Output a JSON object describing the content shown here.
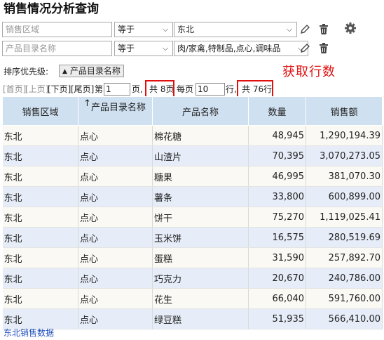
{
  "title": "销售情况分析查询",
  "filters": [
    {
      "field_placeholder": "销售区域",
      "operator": "等于",
      "value": "东北"
    },
    {
      "field_placeholder": "产品目录名称",
      "operator": "等于",
      "value": "肉/家禽,特制品,点心,调味品"
    }
  ],
  "icons": {
    "edit": "pencil-icon",
    "delete": "trash-icon",
    "settings": "gear-icon",
    "dropdown": "chevron-down-icon",
    "sort": "sort-up-triangle-icon"
  },
  "sort": {
    "label": "排序优先级:",
    "chip": "产品目录名称"
  },
  "annotation": "获取行数",
  "pager": {
    "first": "[首页]",
    "prev": "[上页]",
    "next": "[下页]",
    "last": "[尾页]",
    "page_prefix": "第",
    "page_value": "1",
    "page_suffix": "页,",
    "total_pages": "共 8页",
    "per_page_label": "每页",
    "per_page_value": "10",
    "rows_suffix": "行,",
    "total_rows": "共 76行"
  },
  "table": {
    "sort_arrow": "↑",
    "columns": [
      "销售区域",
      "产品目录名称",
      "产品名称",
      "数量",
      "销售额"
    ],
    "rows": [
      [
        "东北",
        "点心",
        "棉花糖",
        "48,945",
        "1,290,194.39"
      ],
      [
        "东北",
        "点心",
        "山渣片",
        "70,395",
        "3,070,273.05"
      ],
      [
        "东北",
        "点心",
        "糖果",
        "46,995",
        "381,070.30"
      ],
      [
        "东北",
        "点心",
        "薯条",
        "33,800",
        "600,899.00"
      ],
      [
        "东北",
        "点心",
        "饼干",
        "75,270",
        "1,119,025.41"
      ],
      [
        "东北",
        "点心",
        "玉米饼",
        "16,575",
        "280,519.69"
      ],
      [
        "东北",
        "点心",
        "蛋糕",
        "31,590",
        "257,892.70"
      ],
      [
        "东北",
        "点心",
        "巧克力",
        "20,670",
        "240,786.00"
      ],
      [
        "东北",
        "点心",
        "花生",
        "66,040",
        "591,760.00"
      ],
      [
        "东北",
        "点心",
        "绿豆糕",
        "51,935",
        "566,410.00"
      ]
    ]
  },
  "footer_link": "东北销售数据"
}
